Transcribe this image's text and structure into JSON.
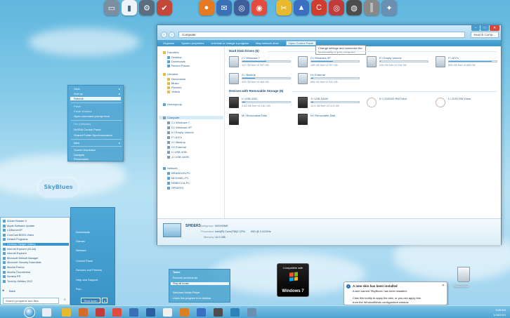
{
  "window": {
    "address": "Computer",
    "search_placeholder": "Search Comp...",
    "toolbar": [
      "Organize",
      "System properties",
      "Uninstall or change a program",
      "Map network drive",
      "Open Control Panel"
    ],
    "tooltip": "Change settings and customize the functionality of your computer.",
    "nav": {
      "favorites_header": "Favorites",
      "favorites": [
        "Desktop",
        "Downloads",
        "Recent Places"
      ],
      "libraries_header": "Libraries",
      "libraries": [
        "Documents",
        "Music",
        "Pictures",
        "Videos"
      ],
      "homegroup": "Homegroup",
      "computer": "Computer",
      "computer_items": [
        "C:\\ Windows 7",
        "D:\\ Windows XP",
        "E:\\ Empty Volume",
        "F:\\ A/V's",
        "G:\\ Backup",
        "H:\\ External",
        "I:\\ USB 4GB",
        "J:\\ USB 16GB"
      ],
      "network_header": "Network",
      "network_items": [
        "BRANDON-PC",
        "MICHAEL-PC",
        "REBECCA-PC",
        "SPIDER3"
      ]
    },
    "hdd_group": "Hard Disk Drives (6)",
    "hdd": [
      {
        "name": "C:\\ Windows 7",
        "free": "147 GB free of 297 GB",
        "used": 0.5
      },
      {
        "name": "D:\\ Windows XP",
        "free": "159 GB free of 297 GB",
        "used": 0.46
      },
      {
        "name": "E:\\ Empty Volume",
        "free": "216 GB free of 216 GB",
        "used": 0.02
      },
      {
        "name": "F:\\ A/V's",
        "free": "605 GB free of 465 GB",
        "used": 0.9
      },
      {
        "name": "G:\\ Backup",
        "free": "343 GB free of 465 GB",
        "used": 0.26
      },
      {
        "name": "H:\\ External",
        "free": "896 GB free of 931 GB",
        "used": 0.04
      }
    ],
    "removable_group": "Devices with Removable Storage (6)",
    "removable": [
      {
        "name": "I:\\ USB 4GB",
        "free": "3.82 GB free of 3.62 GB",
        "used": 0.06,
        "kind": "usb"
      },
      {
        "name": "J:\\ USB 16GB",
        "free": "14.9 GB free of 14.9 GB",
        "used": 0.04,
        "kind": "usb"
      },
      {
        "name": "K:\\ CD/DVD RW Drive",
        "free": "",
        "kind": "cd"
      },
      {
        "name": "L:\\ DVD RW Drive",
        "free": "",
        "kind": "cd"
      },
      {
        "name": "M:\\ Removable Disk",
        "free": "",
        "kind": "usb"
      },
      {
        "name": "N:\\ Removable Disk",
        "free": "",
        "kind": "usb"
      }
    ],
    "details": {
      "name": "SPIDER3",
      "workgroup_label": "Workgroup:",
      "workgroup": "WGHOME",
      "processor_label": "Processor:",
      "processor": "Intel(R) Core(TM)2 CPU",
      "processor_speed": "950 @ 2.42GHz",
      "memory_label": "Memory:",
      "memory": "12.0 GB"
    }
  },
  "context_menu": [
    "View",
    "Sort by",
    "Refresh",
    "Paste",
    "Paste shortcut",
    "Open command prompt here",
    "Pin (Ultimate)",
    "NVIDIA Control Panel",
    "Shared Folder Synchronization",
    "New",
    "Screen resolution",
    "Gadgets",
    "Personalize"
  ],
  "logo": "SkyBlues",
  "start_menu": {
    "programs": [
      "Adobe Reader X",
      "Apple Software Update",
      "CDBurnerXP",
      "ComCast BEED-Video",
      "Default Programs",
      "Desktop Gadget Gallery",
      "Internet Explorer (64-bit)",
      "Internet Explorer",
      "Microsoft Default Manager",
      "Microsoft Security Essentials",
      "Mozilla Firefox",
      "Mozilla Thunderbird",
      "Sentela PR",
      "TuneUp Utilities 2012"
    ],
    "back": "Back",
    "search_placeholder": "Search programs and files",
    "right": [
      "Downloads",
      "Games",
      "Network",
      "Control Panel",
      "Devices and Printers",
      "Help and Support",
      "Run..."
    ],
    "shutdown": "Shut down"
  },
  "jump_list": {
    "title": "Tasks",
    "items": [
      "Resume previous list",
      "Play all music",
      "Windows Media Player",
      "Unpin this program from taskbar"
    ]
  },
  "compat": {
    "line1": "Compatible with",
    "line2": "Windows 7"
  },
  "recycle": "Recycle Bin",
  "balloon": {
    "title": "A new skin has been installed",
    "line1": "A skin named 'SkyBlues' has been installed.",
    "line2": "Click this tooltip to apply the skin, or you can apply this",
    "line3": "from the WindowBlinds configuration window."
  },
  "clock": {
    "time": "3:05 AM",
    "date": "1/25/2012"
  },
  "colors": {
    "accent": "#3a93c9",
    "taskbar": "#4da3d1",
    "window_border": "#3a8fc0"
  }
}
